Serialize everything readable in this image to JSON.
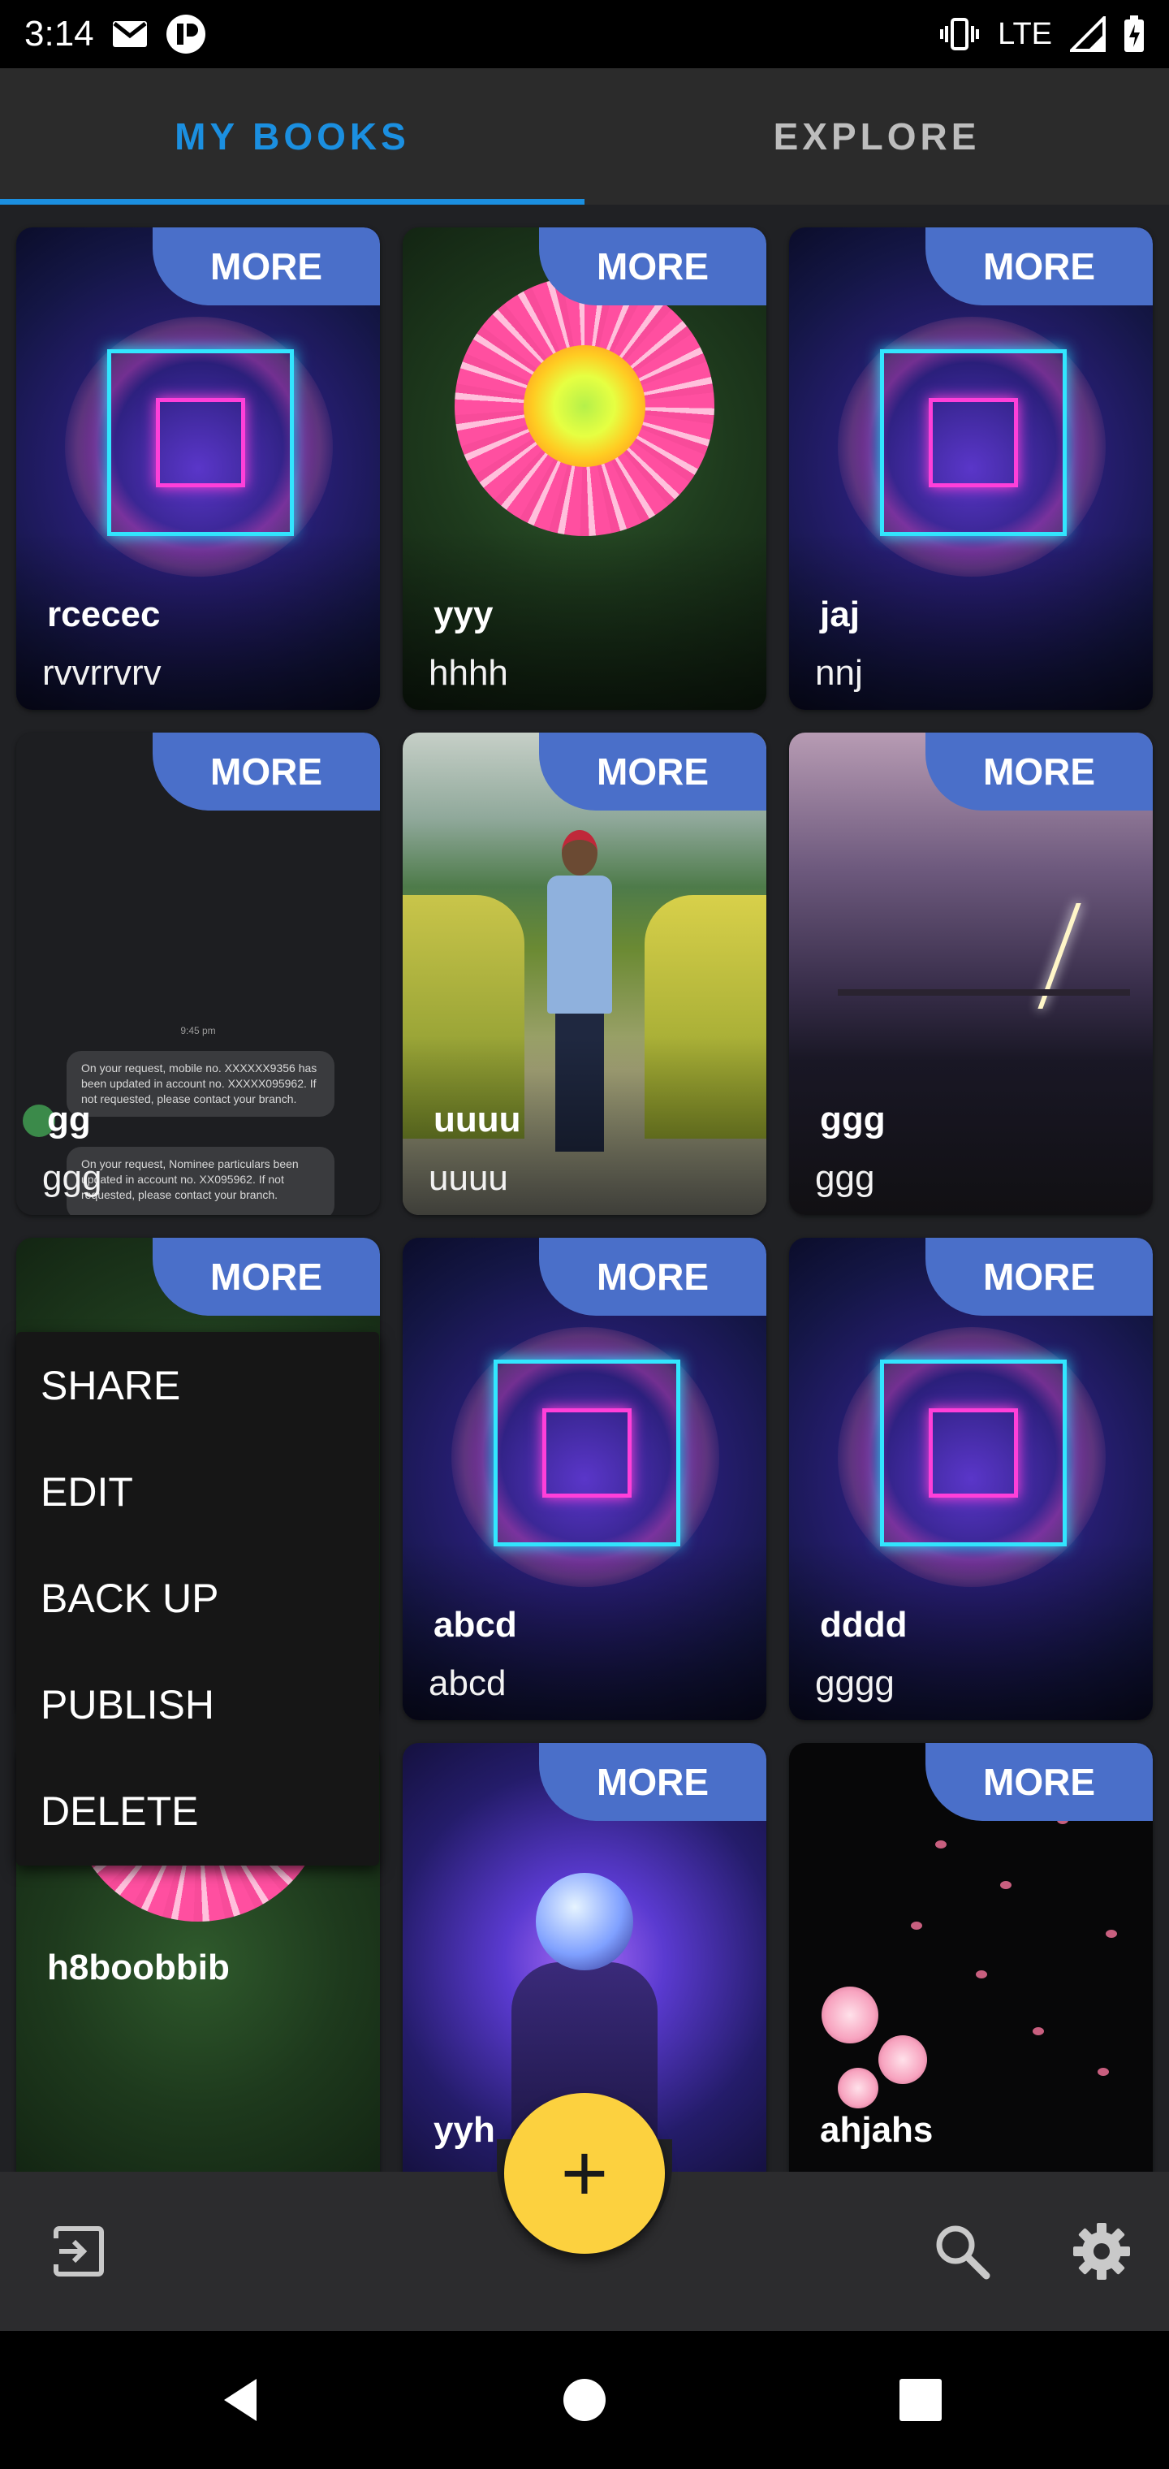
{
  "status_bar": {
    "time": "3:14",
    "network_label": "LTE",
    "icons": [
      "gmail-icon",
      "app-notification-icon",
      "vibrate-icon",
      "signal-icon",
      "battery-icon"
    ]
  },
  "tabs": [
    {
      "label": "MY BOOKS",
      "active": true
    },
    {
      "label": "EXPLORE",
      "active": false
    }
  ],
  "accent_color": "#1b8fe0",
  "more_label": "MORE",
  "books": [
    {
      "title": "rcecec",
      "subtitle": "rvvrrvrv",
      "cover": "neon-frame"
    },
    {
      "title": "yyy",
      "subtitle": "hhhh",
      "cover": "pink-flower"
    },
    {
      "title": "jaj",
      "subtitle": "nnj",
      "cover": "neon-frame"
    },
    {
      "title": "gg",
      "subtitle": "ggg",
      "cover": "sms-screenshot"
    },
    {
      "title": "uuuu",
      "subtitle": "uuuu",
      "cover": "person-garden"
    },
    {
      "title": "ggg",
      "subtitle": "ggg",
      "cover": "storm"
    },
    {
      "title": "h8boobbib",
      "subtitle": "",
      "cover": "pink-flower"
    },
    {
      "title": "abcd",
      "subtitle": "abcd",
      "cover": "neon-frame"
    },
    {
      "title": "dddd",
      "subtitle": "gggg",
      "cover": "neon-frame"
    },
    {
      "title": "yyh",
      "subtitle": "",
      "cover": "astronaut"
    },
    {
      "title": "ahjahs",
      "subtitle": "",
      "cover": "cherry-blossom"
    }
  ],
  "sms_preview": {
    "time": "9:45 pm",
    "message1": "On your request, mobile no. XXXXXX9356 has been updated in account no. XXXXX095962. If not requested, please contact your branch.",
    "message2": "On your request, Nominee particulars been updated in account no. XX095962. If not requested, please contact your branch."
  },
  "context_menu": {
    "items": [
      "SHARE",
      "EDIT",
      "BACK UP",
      "PUBLISH",
      "DELETE"
    ]
  },
  "bottom_bar": {
    "fab_label": "+",
    "fab_color": "#fcd13f",
    "icons": [
      "logout-icon",
      "search-icon",
      "settings-icon"
    ]
  }
}
